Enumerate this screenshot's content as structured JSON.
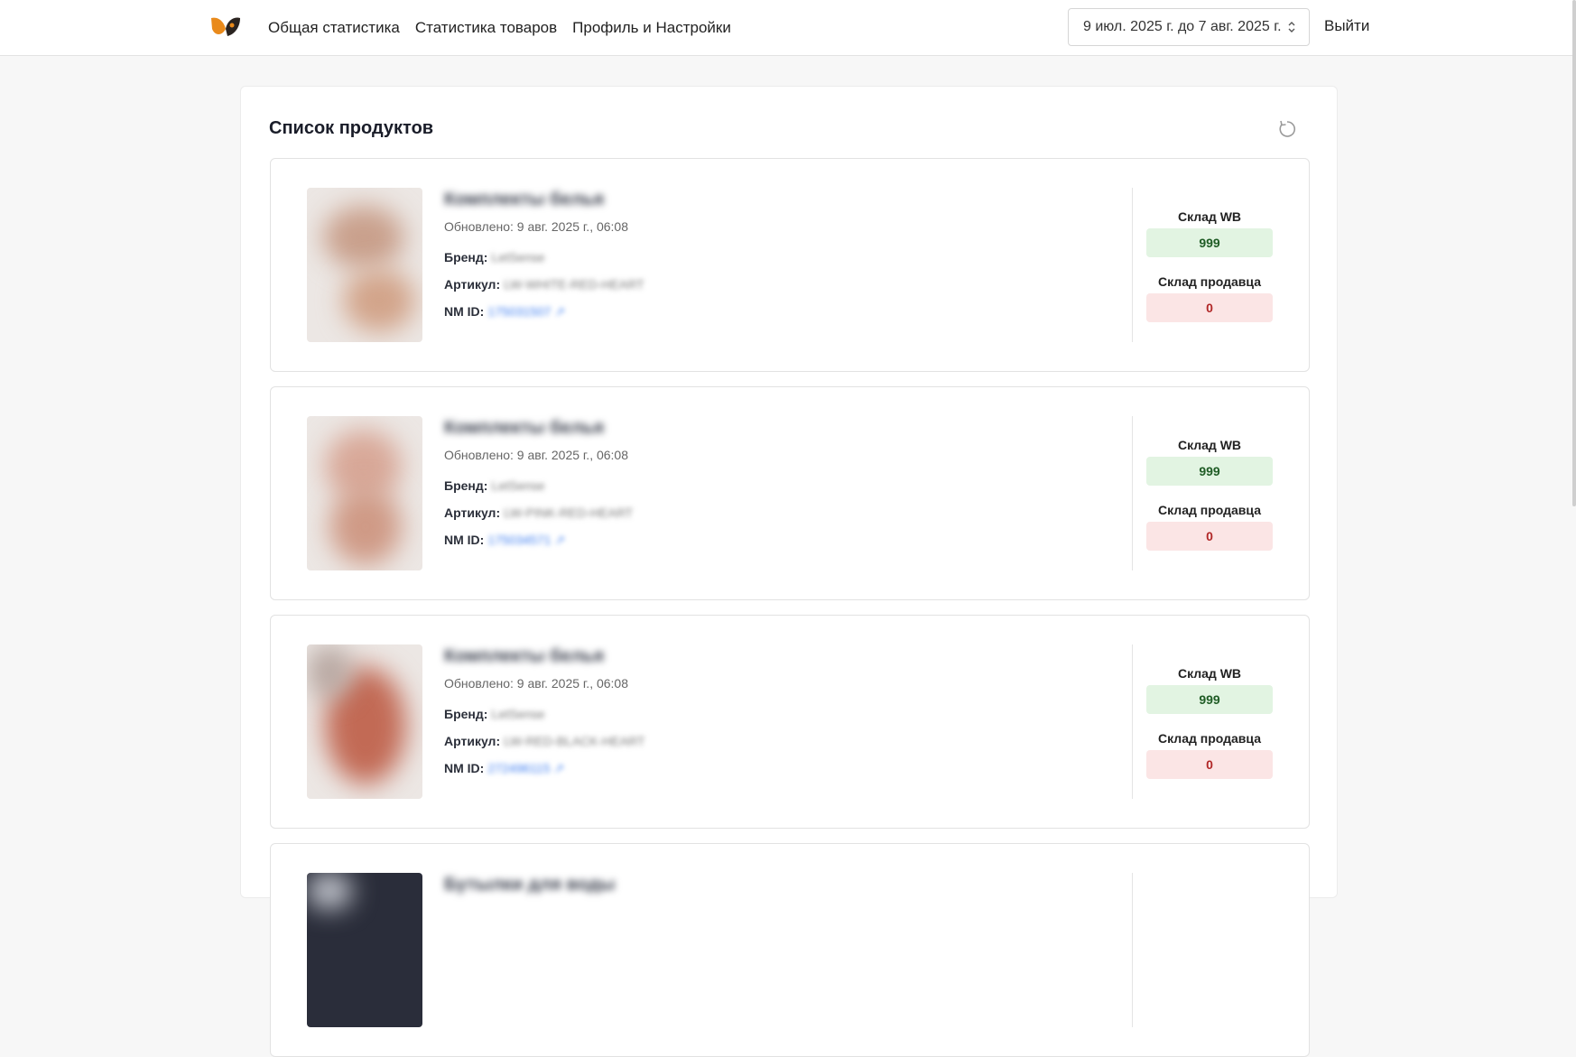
{
  "header": {
    "nav": [
      "Общая статистика",
      "Статистика товаров",
      "Профиль и Настройки"
    ],
    "date_range": "9 июл. 2025 г. до 7 авг. 2025 г.",
    "logout": "Выйти"
  },
  "panel": {
    "title": "Список продуктов"
  },
  "labels": {
    "brand": "Бренд:",
    "article": "Артикул:",
    "nm_id": "NM ID:",
    "stock_wb": "Склад WB",
    "stock_seller": "Склад продавца"
  },
  "products": [
    {
      "name": "Комплекты белья",
      "updated": "Обновлено: 9 авг. 2025 г., 06:08",
      "brand": "LetSense",
      "article": "LW-WHITE-RED-HEART",
      "nm_id": "175031507 ↗",
      "stock_wb": "999",
      "stock_seller": "0"
    },
    {
      "name": "Комплекты белья",
      "updated": "Обновлено: 9 авг. 2025 г., 06:08",
      "brand": "LetSense",
      "article": "LW-PINK-RED-HEART",
      "nm_id": "175034571 ↗",
      "stock_wb": "999",
      "stock_seller": "0"
    },
    {
      "name": "Комплекты белья",
      "updated": "Обновлено: 9 авг. 2025 г., 06:08",
      "brand": "LetSense",
      "article": "LW-RED-BLACK-HEART",
      "nm_id": "272496115 ↗",
      "stock_wb": "999",
      "stock_seller": "0"
    },
    {
      "name": "Бутылки для воды"
    }
  ],
  "colors": {
    "stock_ok_bg": "#e2f4e2",
    "stock_zero_bg": "#fbe5e5",
    "link": "#3b7cf0"
  }
}
